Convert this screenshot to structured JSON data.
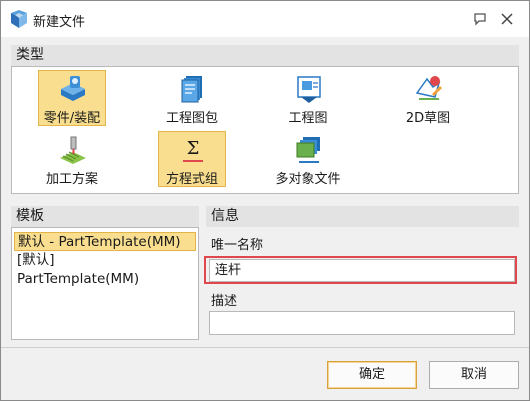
{
  "window": {
    "title": "新建文件"
  },
  "type_section": {
    "header": "类型",
    "items": [
      {
        "label": "零件/装配",
        "icon": "part-assembly-icon",
        "selected": true
      },
      {
        "label": "工程图包",
        "icon": "drawing-package-icon",
        "selected": false
      },
      {
        "label": "工程图",
        "icon": "drawing-icon",
        "selected": false
      },
      {
        "label": "2D草图",
        "icon": "2d-sketch-icon",
        "selected": false
      },
      {
        "label": "加工方案",
        "icon": "machining-plan-icon",
        "selected": false
      },
      {
        "label": "方程式组",
        "icon": "equation-set-icon",
        "selected": true
      },
      {
        "label": "多对象文件",
        "icon": "multi-object-file-icon",
        "selected": false
      }
    ]
  },
  "template_section": {
    "header": "模板",
    "items": [
      {
        "label": "默认 - PartTemplate(MM)",
        "selected": true
      },
      {
        "label": "[默认]",
        "selected": false
      },
      {
        "label": "PartTemplate(MM)",
        "selected": false
      }
    ]
  },
  "info_section": {
    "header": "信息",
    "unique_name_label": "唯一名称",
    "unique_name_value": "连杆",
    "description_label": "描述",
    "description_value": ""
  },
  "buttons": {
    "ok": "确定",
    "cancel": "取消"
  },
  "colors": {
    "selection_fill": "#f8de8e",
    "selection_border": "#e3b549",
    "highlight_box": "#e0474c"
  }
}
